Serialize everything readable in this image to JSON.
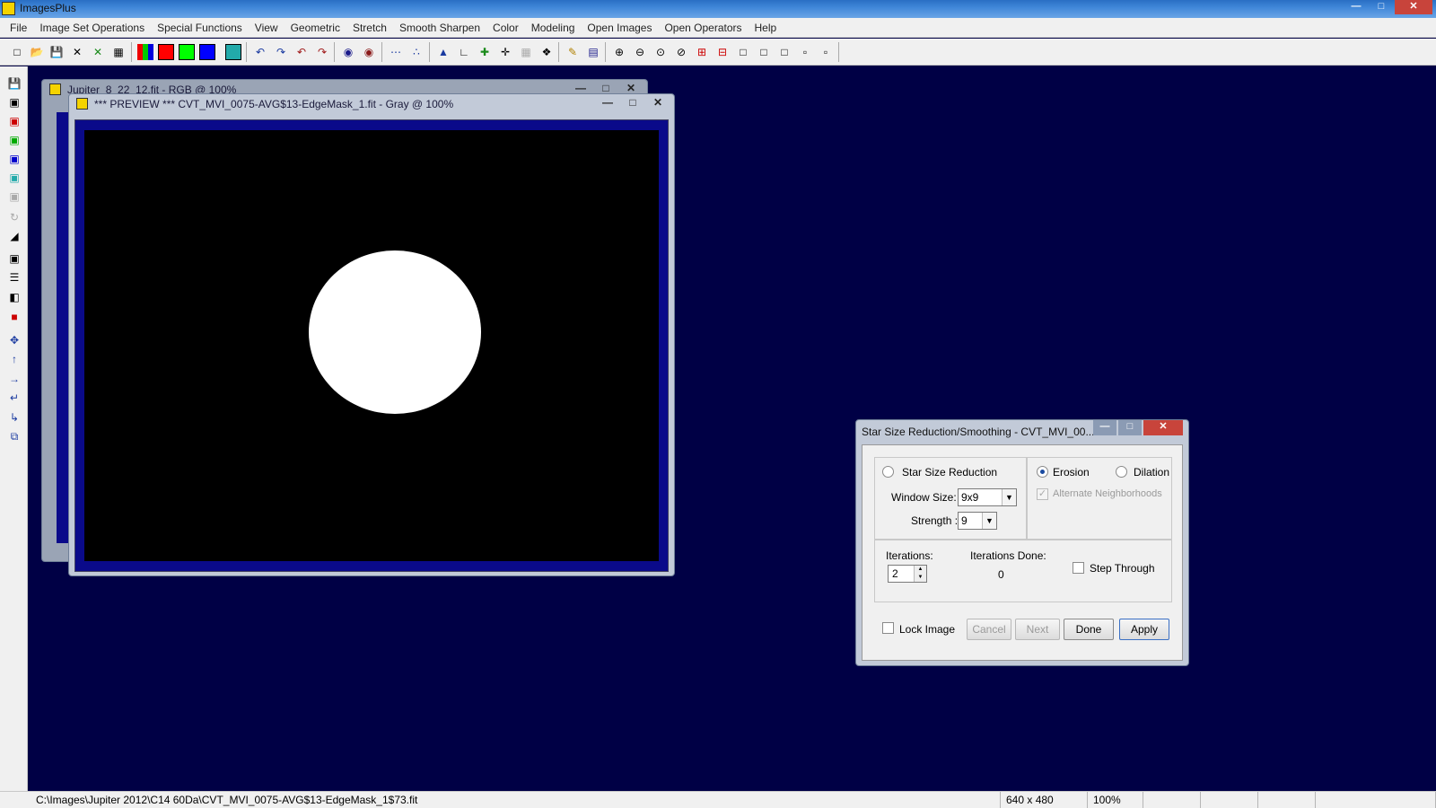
{
  "app": {
    "title": "ImagesPlus"
  },
  "menu": [
    "File",
    "Image Set Operations",
    "Special Functions",
    "View",
    "Geometric",
    "Stretch",
    "Smooth Sharpen",
    "Color",
    "Modeling",
    "Open Images",
    "Open Operators",
    "Help"
  ],
  "windows": {
    "back_title": "Jupiter_8_22_12.fit - RGB @ 100%",
    "preview_title": "*** PREVIEW *** CVT_MVI_0075-AVG$13-EdgeMask_1.fit - Gray @ 100%"
  },
  "dialog": {
    "title": "Star Size Reduction/Smoothing - CVT_MVI_00...",
    "star_size_reduction_label": "Star Size Reduction",
    "erosion_label": "Erosion",
    "dilation_label": "Dilation",
    "window_size_label": "Window Size:",
    "window_size_value": "9x9",
    "alternate_neighborhoods_label": "Alternate Neighborhoods",
    "strength_label": "Strength :",
    "strength_value": "9",
    "iterations_label": "Iterations:",
    "iterations_value": "2",
    "iterations_done_label": "Iterations Done:",
    "iterations_done_value": "0",
    "step_through_label": "Step Through",
    "lock_image_label": "Lock Image",
    "cancel_label": "Cancel",
    "next_label": "Next",
    "done_label": "Done",
    "apply_label": "Apply"
  },
  "status": {
    "path": "C:\\Images\\Jupiter 2012\\C14 60Da\\CVT_MVI_0075-AVG$13-EdgeMask_1$73.fit",
    "dimensions": "640 x 480",
    "zoom": "100%"
  }
}
